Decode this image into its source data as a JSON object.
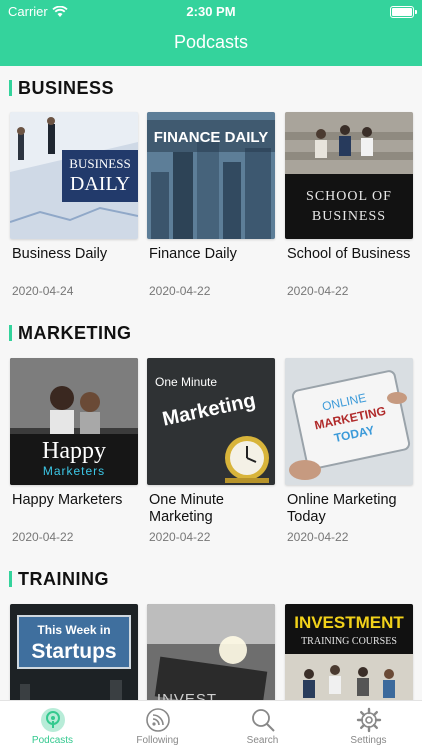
{
  "status_bar": {
    "carrier": "Carrier",
    "time": "2:30 PM"
  },
  "header": {
    "title": "Podcasts"
  },
  "sections": [
    {
      "title": "BUSINESS",
      "items": [
        {
          "title": "Business Daily",
          "date": "2020-04-24",
          "art_lines": [
            "BUSINESS",
            "DAILY"
          ]
        },
        {
          "title": "Finance Daily",
          "date": "2020-04-22",
          "art_lines": [
            "FINANCE DAILY"
          ]
        },
        {
          "title": "School of Business",
          "date": "2020-04-22",
          "art_lines": [
            "SCHOOL OF",
            "BUSINESS"
          ]
        }
      ]
    },
    {
      "title": "MARKETING",
      "items": [
        {
          "title": "Happy Marketers",
          "date": "2020-04-22",
          "art_lines": [
            "Happy",
            "Marketers"
          ]
        },
        {
          "title": "One Minute Marketing",
          "date": "2020-04-22",
          "art_lines": [
            "One Minute",
            "Marketing"
          ]
        },
        {
          "title": "Online Marketing Today",
          "date": "2020-04-22",
          "art_lines": [
            "ONLINE",
            "MARKETING",
            "TODAY"
          ]
        }
      ]
    },
    {
      "title": "TRAINING",
      "items": [
        {
          "art_lines": [
            "This Week in",
            "Startups"
          ]
        },
        {
          "art_lines": [
            "INVEST"
          ]
        },
        {
          "art_lines": [
            "INVESTMENT",
            "TRAINING COURSES"
          ]
        }
      ]
    }
  ],
  "tabbar": {
    "tabs": [
      {
        "label": "Podcasts",
        "icon": "podcast-icon",
        "active": true
      },
      {
        "label": "Following",
        "icon": "rss-icon",
        "active": false
      },
      {
        "label": "Search",
        "icon": "search-icon",
        "active": false
      },
      {
        "label": "Settings",
        "icon": "gear-icon",
        "active": false
      }
    ]
  },
  "colors": {
    "accent": "#34d39c",
    "tab_active": "#34c98f",
    "tab_inactive": "#888888"
  }
}
